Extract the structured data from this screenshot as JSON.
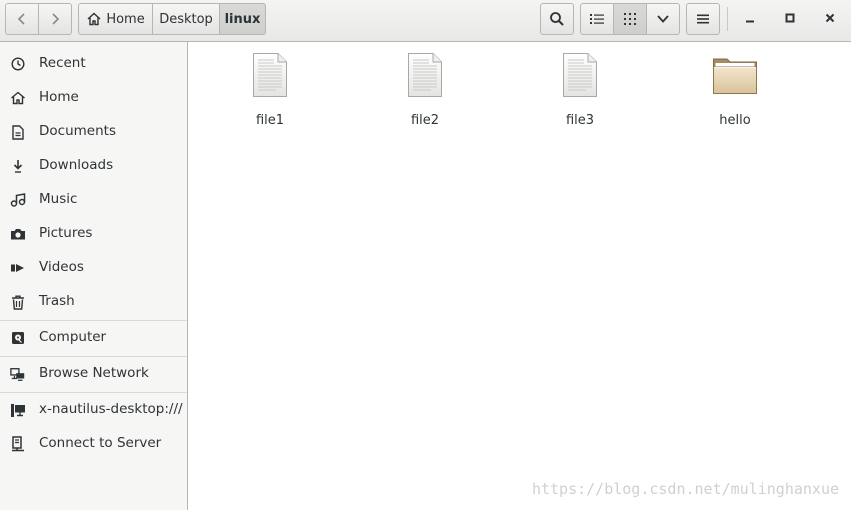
{
  "toolbar": {
    "back_icon": "chevron-left-icon",
    "forward_icon": "chevron-right-icon",
    "breadcrumbs": [
      "Home",
      "Desktop",
      "linux"
    ],
    "search_icon": "search-icon",
    "list_view_icon": "list-view-icon",
    "grid_view_icon": "grid-view-icon",
    "view_options_icon": "chevron-down-icon",
    "menu_icon": "hamburger-menu-icon",
    "minimize_icon": "minimize-icon",
    "maximize_icon": "maximize-icon",
    "close_icon": "close-icon"
  },
  "sidebar": {
    "places": [
      {
        "label": "Recent",
        "icon": "clock-icon"
      },
      {
        "label": "Home",
        "icon": "home-icon"
      },
      {
        "label": "Documents",
        "icon": "document-icon"
      },
      {
        "label": "Downloads",
        "icon": "download-icon"
      },
      {
        "label": "Music",
        "icon": "music-icon"
      },
      {
        "label": "Pictures",
        "icon": "camera-icon"
      },
      {
        "label": "Videos",
        "icon": "video-icon"
      },
      {
        "label": "Trash",
        "icon": "trash-icon"
      }
    ],
    "devices": [
      {
        "label": "Computer",
        "icon": "drive-icon"
      }
    ],
    "network": [
      {
        "label": "Browse Network",
        "icon": "network-icon"
      }
    ],
    "other": [
      {
        "label": "x-nautilus-desktop:///",
        "icon": "desktop-icon"
      },
      {
        "label": "Connect to Server",
        "icon": "server-icon"
      }
    ]
  },
  "files": [
    {
      "name": "file1",
      "type": "file"
    },
    {
      "name": "file2",
      "type": "file"
    },
    {
      "name": "file3",
      "type": "file"
    },
    {
      "name": "hello",
      "type": "folder"
    }
  ],
  "watermark": "https://blog.csdn.net/mulinghanxue"
}
